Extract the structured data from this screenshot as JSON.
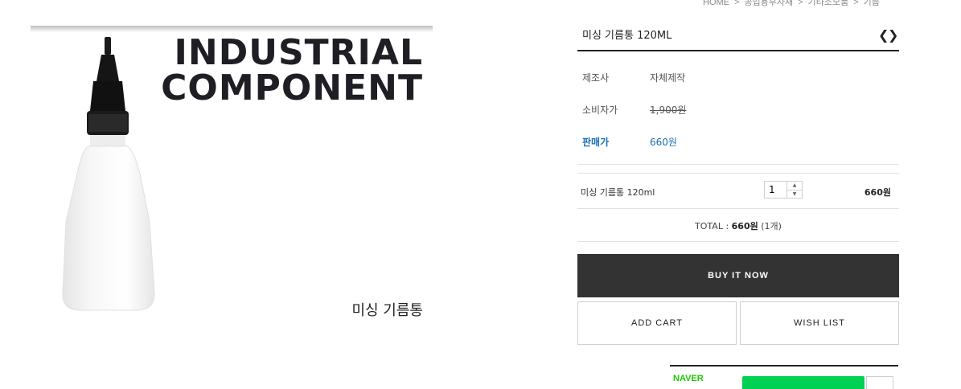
{
  "breadcrumb": {
    "items": [
      "HOME",
      "공업용부자재",
      "기타소모품",
      "기름"
    ],
    "separator": ">"
  },
  "product_image": {
    "headline_line1": "INDUSTRIAL",
    "headline_line2": "COMPONENT",
    "caption": "미싱 기름통"
  },
  "product": {
    "title": "미싱 기름통 120ML",
    "prev_icon": "chevron-left-icon",
    "next_icon": "chevron-right-icon",
    "specs": [
      {
        "label": "제조사",
        "value": "자체제작"
      },
      {
        "label": "소비자가",
        "value": "1,900원"
      },
      {
        "label": "판매가",
        "value": "660원"
      }
    ],
    "sale_color": "#1a6fb5"
  },
  "option": {
    "name": "미싱 기름통 120ml",
    "quantity": "1",
    "price": "660원"
  },
  "total": {
    "label": "TOTAL : ",
    "amount": "660원",
    "count": "(1개)"
  },
  "buttons": {
    "buy_now": "BUY IT NOW",
    "add_cart": "ADD CART",
    "wish_list": "WISH LIST"
  },
  "naver": {
    "logo": "NAVER",
    "brand_color": "#00d152"
  }
}
